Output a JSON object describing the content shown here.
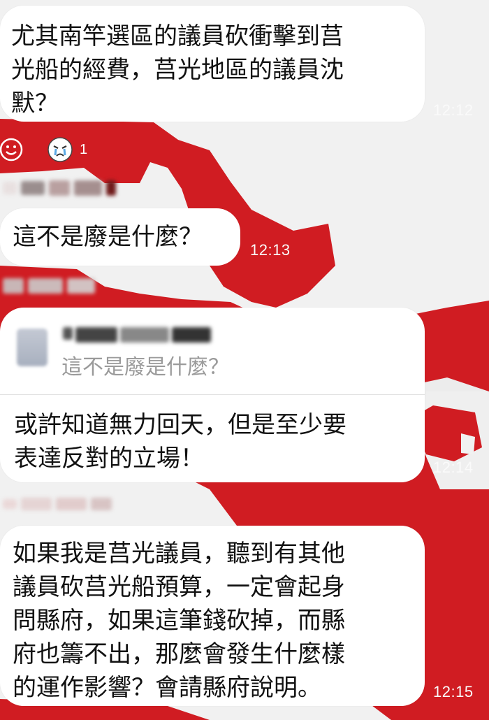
{
  "messages": [
    {
      "text": "尤其南竿選區的議員砍衝擊到莒\n光船的經費，莒光地區的議員沈\n默？",
      "time": "12:12"
    },
    {
      "text": "這不是廢是什麼？",
      "time": "12:13"
    },
    {
      "quote_text": "這不是廢是什麼？",
      "text": "或許知道無力回天，但是至少要\n表達反對的立場！",
      "time": "12:14"
    },
    {
      "text": "如果我是莒光議員，聽到有其他\n議員砍莒光船預算，一定會起身\n問縣府，如果這筆錢砍掉，而縣\n府也籌不出，那麼會發生什麼樣\n的運作影響？會請縣府說明。",
      "time": "12:15"
    }
  ],
  "reactions": {
    "count": "1",
    "add_icon": "smiley-outline-icon",
    "emoji_icon": "crying-face-icon"
  },
  "colors": {
    "background": "#f2f2f2",
    "accent_red": "#d01c22",
    "bubble": "#ffffff",
    "time": "#fafafa"
  }
}
